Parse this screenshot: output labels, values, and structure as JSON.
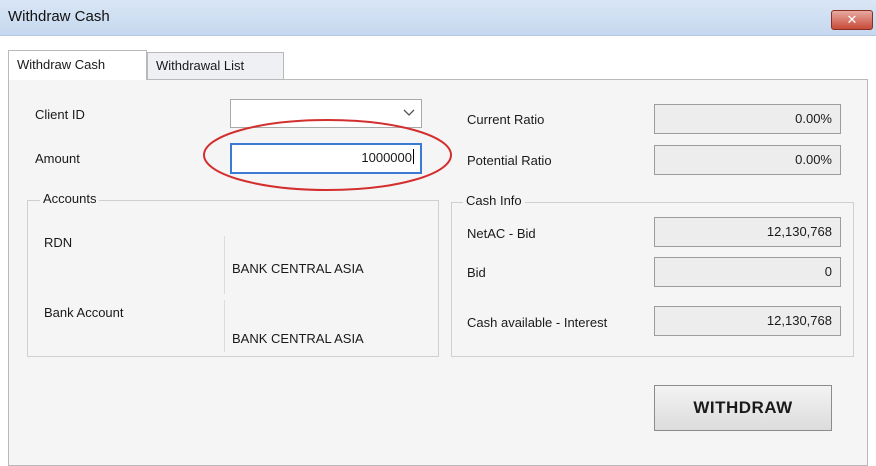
{
  "window": {
    "title": "Withdraw Cash",
    "close_glyph": "✕"
  },
  "tabs": [
    {
      "label": "Withdraw Cash",
      "active": true
    },
    {
      "label": "Withdrawal List",
      "active": false
    }
  ],
  "form": {
    "client_id_label": "Client ID",
    "client_id_value": "",
    "amount_label": "Amount",
    "amount_value": "1000000"
  },
  "ratios": {
    "current_label": "Current Ratio",
    "current_value": "0.00%",
    "potential_label": "Potential Ratio",
    "potential_value": "0.00%"
  },
  "accounts": {
    "title": "Accounts",
    "rdn_label": "RDN",
    "rdn_bank": "BANK CENTRAL ASIA",
    "bank_account_label": "Bank Account",
    "bank_account_bank": "BANK CENTRAL ASIA"
  },
  "cash_info": {
    "title": "Cash Info",
    "netac_label": "NetAC - Bid",
    "netac_value": "12,130,768",
    "bid_label": "Bid",
    "bid_value": "0",
    "cash_available_label": "Cash available - Interest",
    "cash_available_value": "12,130,768"
  },
  "actions": {
    "withdraw_label": "WITHDRAW"
  },
  "colors": {
    "highlight_ellipse": "#d32f2f",
    "input_focus_border": "#3b7bd6",
    "close_button": "#c84a38"
  }
}
